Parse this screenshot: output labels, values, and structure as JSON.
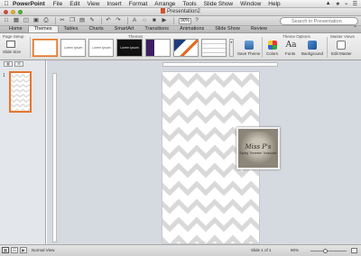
{
  "menubar": {
    "app_name": "PowerPoint",
    "items": [
      "File",
      "Edit",
      "View",
      "Insert",
      "Format",
      "Arrange",
      "Tools",
      "Slide Show",
      "Window",
      "Help"
    ],
    "right_icons": [
      "▲",
      "★",
      "⌁",
      "☰"
    ]
  },
  "window": {
    "title": "Presentation2"
  },
  "toolbar": {
    "zoom_value": "90%",
    "search_placeholder": "Search in Presentation"
  },
  "ribbon_tabs": [
    "Home",
    "Themes",
    "Tables",
    "Charts",
    "SmartArt",
    "Transitions",
    "Animations",
    "Slide Show",
    "Review"
  ],
  "active_tab": "Themes",
  "ribbon": {
    "group_page_setup": "Page Setup",
    "slide_size": "Slide Size",
    "group_themes": "Themes",
    "themes": [
      {
        "label": "",
        "style": "sel"
      },
      {
        "label": "Lorem Ipsum",
        "style": "plain"
      },
      {
        "label": "Lorem Ipsum",
        "style": "plain"
      },
      {
        "label": "Lorem Ipsum",
        "style": "dark"
      },
      {
        "label": "",
        "style": "stripe-purple"
      },
      {
        "label": "",
        "style": "stripe-blue"
      },
      {
        "label": "",
        "style": "lines"
      }
    ],
    "save_theme": "Save Theme",
    "group_theme_options": "Theme Options",
    "colors": "Colors",
    "fonts": "Fonts",
    "background": "Background",
    "group_master_views": "Master Views",
    "edit_master": "Edit Master"
  },
  "pane": {
    "slide_number": "1"
  },
  "watermark": {
    "script": "Miss P's",
    "subtitle": "Spring Trimester Treasures"
  },
  "status": {
    "view_label": "Normal View",
    "slide_counter": "Slide 1 of 1",
    "zoom": "90%"
  },
  "colors": {
    "accent_orange": "#e8762e",
    "chevron_gray": "#d9d9d9",
    "canvas_bg": "#d5d9e0"
  }
}
